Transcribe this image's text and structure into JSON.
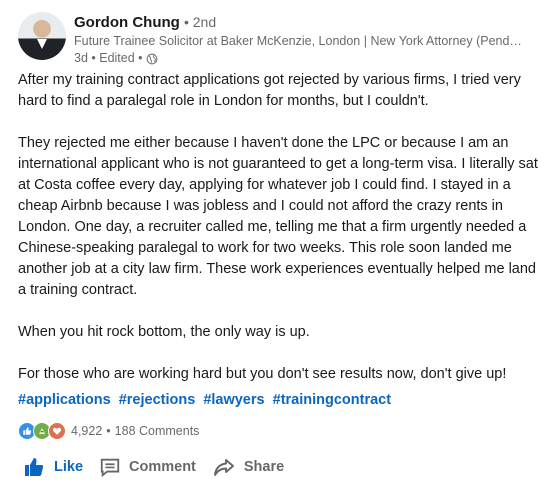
{
  "author": {
    "name": "Gordon Chung",
    "degree": "• 2nd",
    "headline": "Future Trainee Solicitor at Baker McKenzie, London | New York Attorney (Pend…",
    "time": "3d • Edited •"
  },
  "post": {
    "paragraphs": [
      "After my training contract applications got rejected by various firms, I tried very hard to find a paralegal role in London for months, but I couldn't.",
      "They rejected me either because I haven't done the LPC or because I am an international applicant who is not guaranteed to get a long-term visa. I literally sat at Costa coffee every day, applying for whatever job I could find. I stayed in a cheap Airbnb because I was jobless and I could not afford the crazy rents in London. One day, a recruiter called me, telling me that a firm urgently needed a Chinese-speaking paralegal to work for two weeks. This role soon landed me another job at a city law firm. These work experiences eventually helped me land a training contract.",
      "When you hit rock bottom, the only way is up.",
      "For those who are working hard but you don't see results now, don't give up!"
    ],
    "hashtags": [
      "#applications",
      "#rejections",
      "#lawyers",
      "#trainingcontract"
    ]
  },
  "social": {
    "reactions": "4,922",
    "separator": "•",
    "comments": "188 Comments",
    "reaction_icons": [
      "like-reaction-icon",
      "celebrate-reaction-icon",
      "love-reaction-icon"
    ]
  },
  "actions": {
    "like": "Like",
    "comment": "Comment",
    "share": "Share"
  },
  "colors": {
    "link": "#0a66c2",
    "like_reaction": "#378fe9",
    "celebrate_reaction": "#6dae4f",
    "love_reaction": "#df704d"
  }
}
